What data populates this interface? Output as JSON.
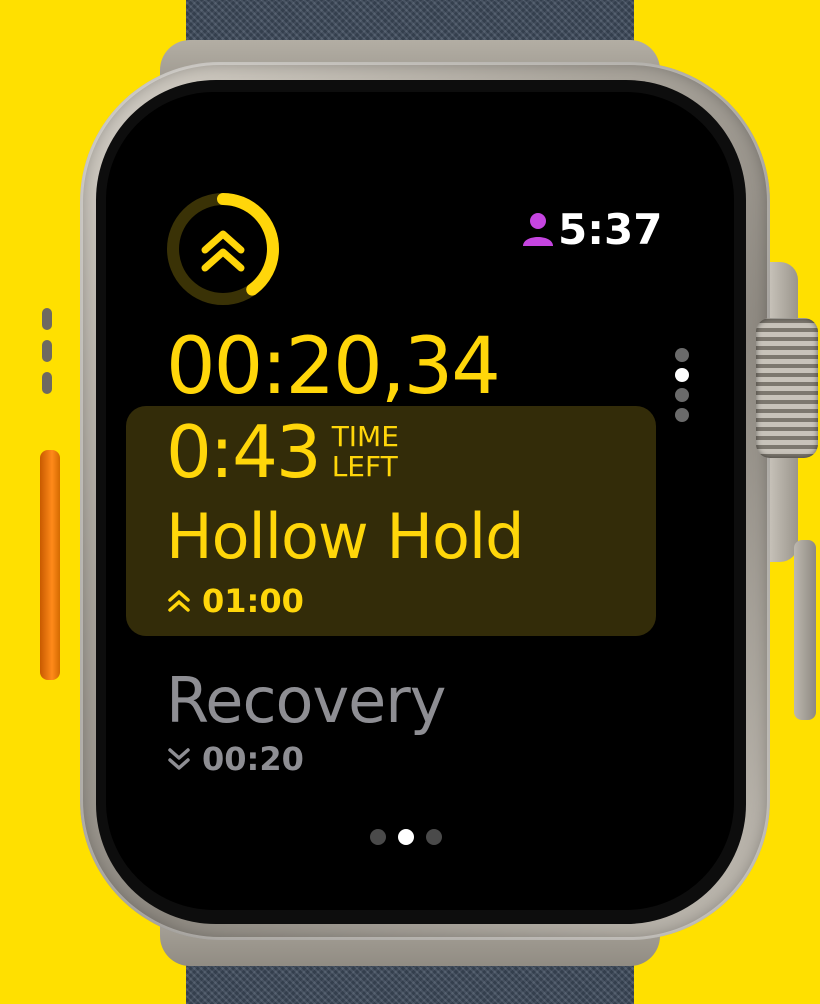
{
  "status": {
    "time": "5:37",
    "person_icon": "person-icon",
    "person_color": "#C545E0"
  },
  "workout": {
    "elapsed": "00:20,34",
    "interval_icon": "chevron-up-double-icon",
    "interval_progress": 0.4
  },
  "current_interval": {
    "time_left": "0:43",
    "time_left_label_top": "TIME",
    "time_left_label_bottom": "LEFT",
    "name": "Hollow Hold",
    "duration": "01:00",
    "duration_icon": "chevron-up-double-icon"
  },
  "next_interval": {
    "name": "Recovery",
    "duration": "00:20",
    "duration_icon": "chevron-down-double-icon"
  },
  "pagination": {
    "vertical": {
      "count": 4,
      "active": 1
    },
    "horizontal": {
      "count": 3,
      "active": 1
    }
  },
  "colors": {
    "accent": "#FFD60A",
    "card_background": "#332C09",
    "secondary_text": "#8E8E93",
    "background": "#FFE000"
  }
}
